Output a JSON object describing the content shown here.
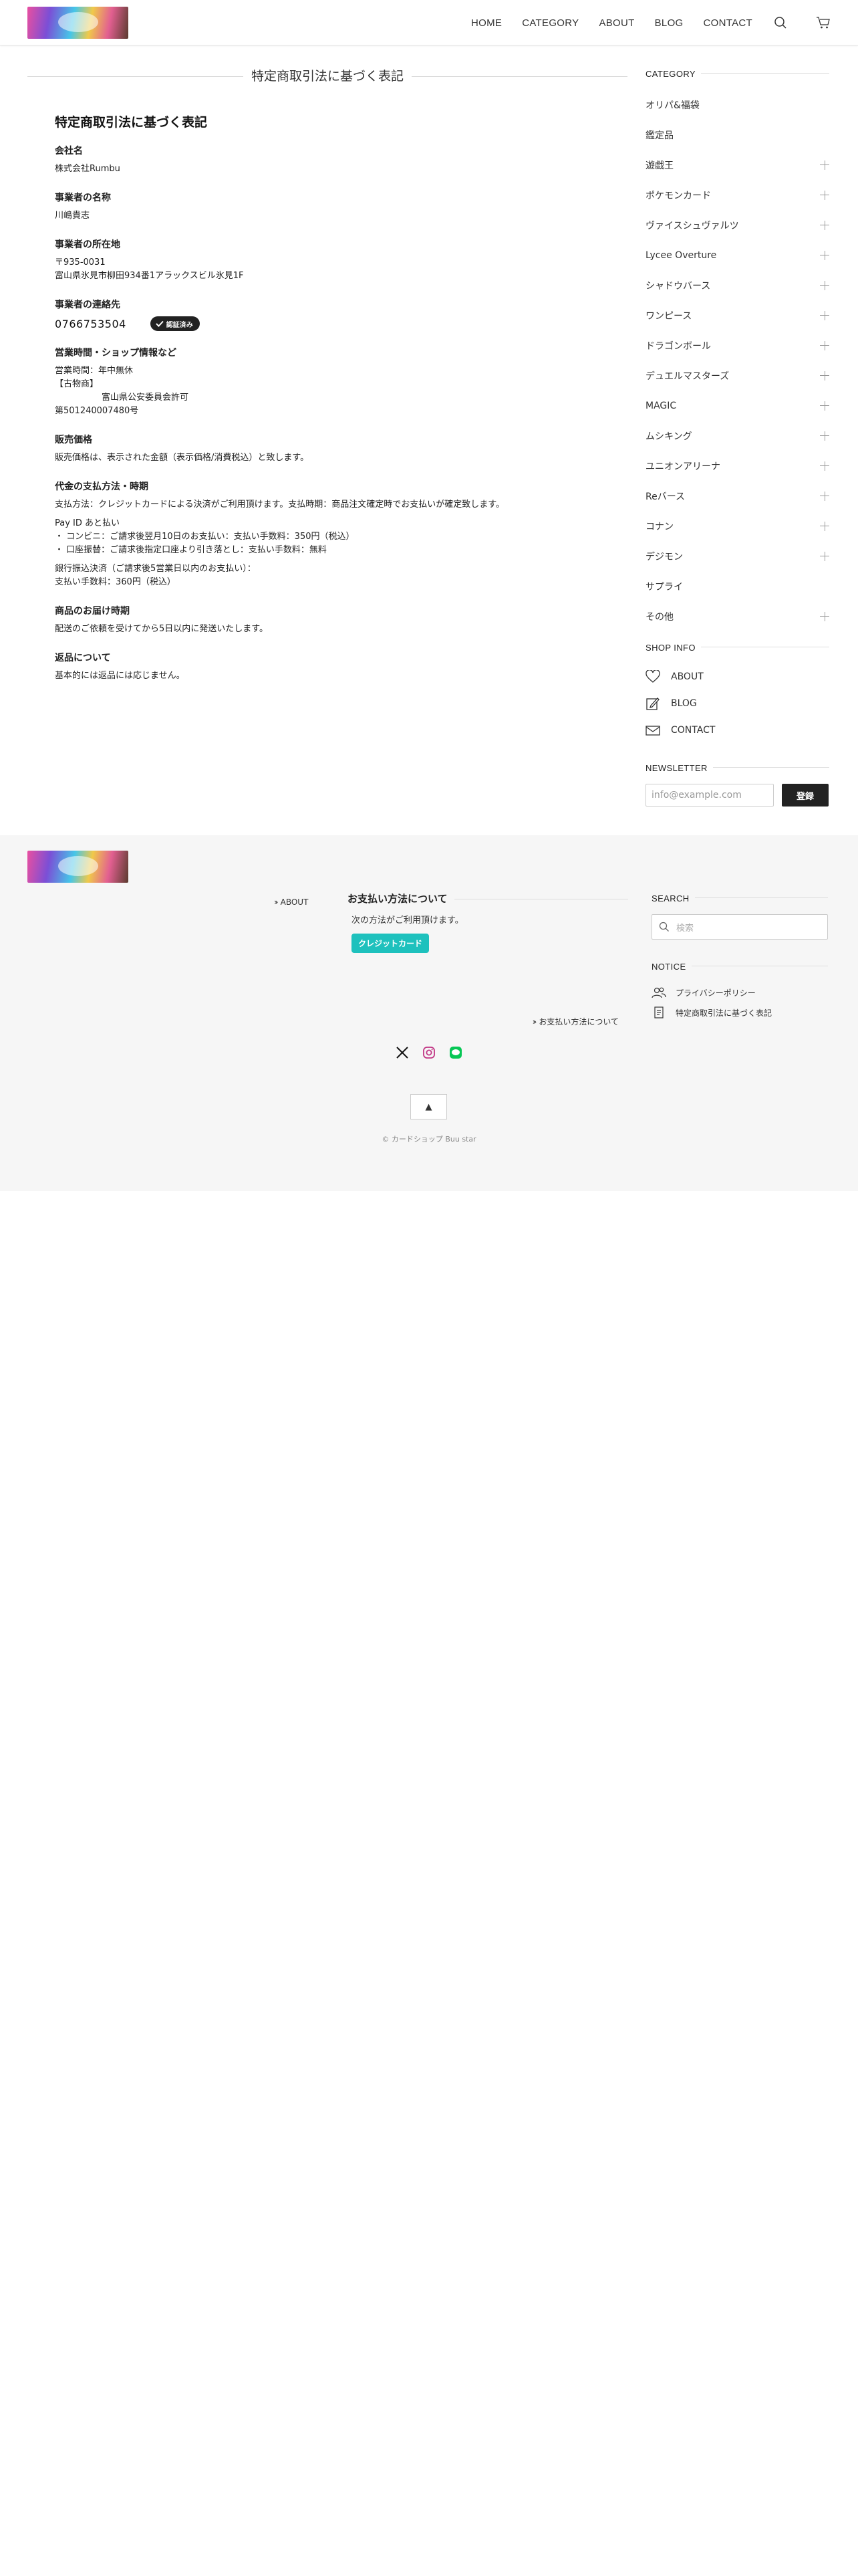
{
  "header": {
    "logo_alt": "カードショップ Buu star",
    "nav": [
      "HOME",
      "CATEGORY",
      "ABOUT",
      "BLOG",
      "CONTACT"
    ],
    "icons": [
      "search-icon",
      "cart-icon"
    ]
  },
  "page": {
    "heading": "特定商取引法に基づく表記",
    "title": "特定商取引法に基づく表記",
    "sections": {
      "company": {
        "h": "会社名",
        "v": "株式会社Rumbu"
      },
      "rep": {
        "h": "事業者の名称",
        "v": "川嶋貴志"
      },
      "address": {
        "h": "事業者の所在地",
        "zip": "〒935-0031",
        "addr": "富山県氷見市柳田934番1アラックスビル氷見1F"
      },
      "contact": {
        "h": "事業者の連絡先",
        "tel": "0766753504",
        "badge": "認証済み"
      },
      "hours": {
        "h": "営業時間・ショップ情報など",
        "l1": "営業時間：年中無休",
        "l2": "【古物商】",
        "l3": "富山県公安委員会許可",
        "l4": "第501240007480号"
      },
      "price": {
        "h": "販売価格",
        "v": "販売価格は、表示された金額（表示価格/消費税込）と致します。"
      },
      "payment": {
        "h": "代金の支払方法・時期",
        "l1": "支払方法：クレジットカードによる決済がご利用頂けます。支払時期：商品注文確定時でお支払いが確定致します。",
        "l2": "Pay ID あと払い",
        "l3": "・ コンビニ：ご請求後翌月10日のお支払い：支払い手数料：350円（税込）",
        "l4": "・ 口座振替：ご請求後指定口座より引き落とし：支払い手数料：無料",
        "l5": "銀行振込決済（ご請求後5営業日以内のお支払い）：",
        "l6": "支払い手数料：360円（税込）"
      },
      "delivery": {
        "h": "商品のお届け時期",
        "v": "配送のご依頼を受けてから5日以内に発送いたします。"
      },
      "returns": {
        "h": "返品について",
        "v": "基本的には返品には応じません。"
      }
    }
  },
  "sidebar": {
    "category_heading": "CATEGORY",
    "categories": [
      {
        "label": "オリパ&福袋",
        "expandable": false
      },
      {
        "label": "鑑定品",
        "expandable": false
      },
      {
        "label": "遊戯王",
        "expandable": true
      },
      {
        "label": "ポケモンカード",
        "expandable": true
      },
      {
        "label": "ヴァイスシュヴァルツ",
        "expandable": true
      },
      {
        "label": "Lycee Overture",
        "expandable": true
      },
      {
        "label": "シャドウバース",
        "expandable": true
      },
      {
        "label": "ワンピース",
        "expandable": true
      },
      {
        "label": "ドラゴンボール",
        "expandable": true
      },
      {
        "label": "デュエルマスターズ",
        "expandable": true
      },
      {
        "label": "MAGIC",
        "expandable": true
      },
      {
        "label": "ムシキング",
        "expandable": true
      },
      {
        "label": "ユニオンアリーナ",
        "expandable": true
      },
      {
        "label": "Reバース",
        "expandable": true
      },
      {
        "label": "コナン",
        "expandable": true
      },
      {
        "label": "デジモン",
        "expandable": true
      },
      {
        "label": "サプライ",
        "expandable": false
      },
      {
        "label": "その他",
        "expandable": true
      }
    ],
    "shopinfo_heading": "SHOP INFO",
    "shopinfo": [
      {
        "label": "ABOUT",
        "icon": "heart-icon"
      },
      {
        "label": "BLOG",
        "icon": "edit-icon"
      },
      {
        "label": "CONTACT",
        "icon": "mail-icon"
      }
    ],
    "newsletter_heading": "NEWSLETTER",
    "newsletter_placeholder": "info@example.com",
    "newsletter_button": "登録"
  },
  "footer": {
    "about_link": "ABOUT",
    "pay_title": "お支払い方法について",
    "pay_sub": "次の方法がご利用頂けます。",
    "pay_badge": "クレジットカード",
    "pay_link": "お支払い方法について",
    "search_heading": "SEARCH",
    "search_placeholder": "検索",
    "notice_heading": "NOTICE",
    "notice": [
      {
        "label": "プライバシーポリシー",
        "icon": "users-icon"
      },
      {
        "label": "特定商取引法に基づく表記",
        "icon": "document-icon"
      }
    ],
    "social": [
      "x-icon",
      "instagram-icon",
      "line-icon"
    ],
    "pagetop": "▲",
    "copyright": "© カードショップ Buu star"
  },
  "colors": {
    "accent": "#1ec1bd",
    "dark": "#222222",
    "footer_bg": "#f6f6f6"
  }
}
